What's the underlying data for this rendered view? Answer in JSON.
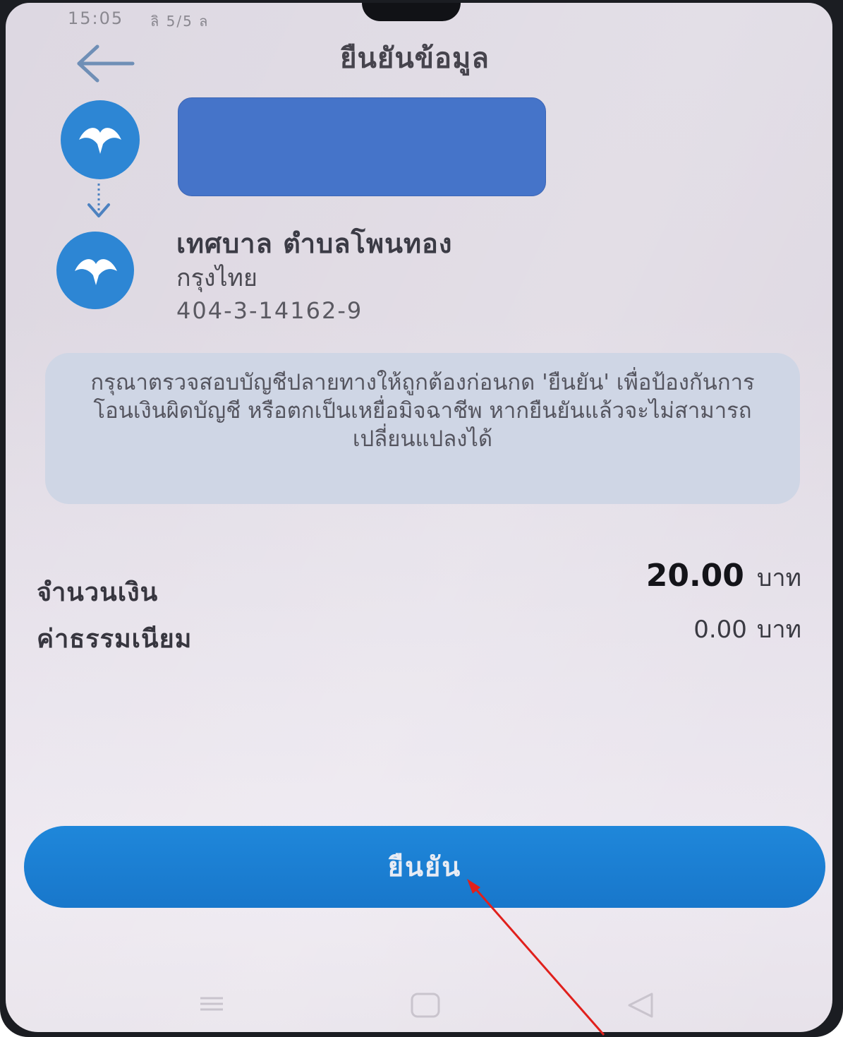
{
  "status_bar": {
    "time": "15:05",
    "icons": "ลิ 5/5 ล"
  },
  "header": {
    "title": "ยืนยันข้อมูล",
    "back_icon": "back-arrow-icon"
  },
  "sender": {
    "logo_icon": "bank-logo-icon",
    "redacted": true
  },
  "recipient": {
    "logo_icon": "bank-logo-icon",
    "name": "เทศบาล ตำบลโพนทอง",
    "bank": "กรุงไทย",
    "account": "404-3-14162-9"
  },
  "warning": {
    "text": "กรุณาตรวจสอบบัญชีปลายทางให้ถูกต้องก่อนกด 'ยืนยัน' เพื่อป้องกันการโอนเงินผิดบัญชี หรือตกเป็นเหยื่อมิจฉาชีพ หากยืนยันแล้วจะไม่สามารถเปลี่ยนแปลงได้"
  },
  "amount": {
    "label": "จำนวนเงิน",
    "value": "20.00",
    "unit": "บาท"
  },
  "fee": {
    "label": "ค่าธรรมเนียม",
    "value": "0.00",
    "unit": "บาท"
  },
  "actions": {
    "confirm_label": "ยืนยัน"
  },
  "colors": {
    "accent": "#1f87da",
    "redaction": "#4574c9",
    "annotation_arrow": "#e0201c"
  }
}
